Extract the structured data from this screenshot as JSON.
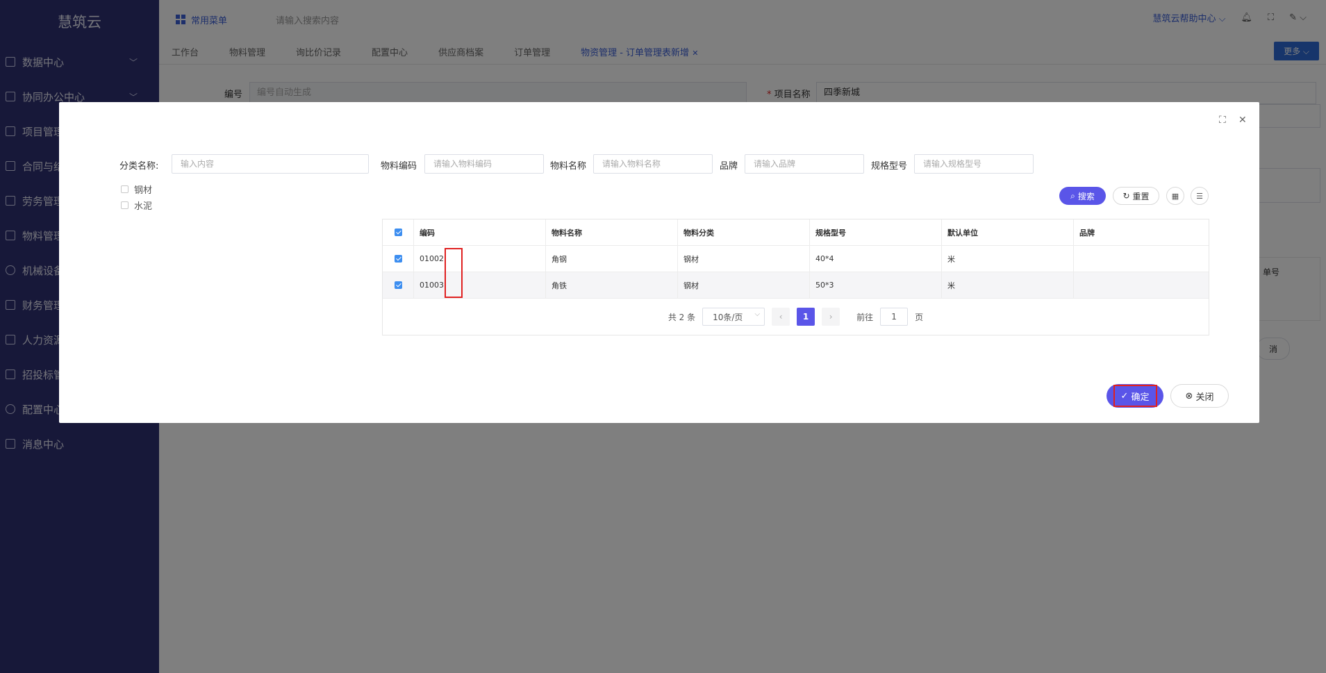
{
  "app": {
    "brand": "慧筑云"
  },
  "sidebar": {
    "items": [
      {
        "label": "数据中心",
        "icon": "grid-icon"
      },
      {
        "label": "协同办公中心",
        "icon": "send-icon"
      },
      {
        "label": "项目管理",
        "icon": "book-icon"
      },
      {
        "label": "合同与结",
        "icon": "edit-icon"
      },
      {
        "label": "劳务管理",
        "icon": "user-icon"
      },
      {
        "label": "物料管理",
        "icon": "edit-icon"
      },
      {
        "label": "机械设备",
        "icon": "gear-circle-icon"
      },
      {
        "label": "财务管理",
        "icon": "phone-icon"
      },
      {
        "label": "人力资源",
        "icon": "phone-icon"
      },
      {
        "label": "招投标管",
        "icon": "swap-icon"
      },
      {
        "label": "配置中心",
        "icon": "settings-icon"
      },
      {
        "label": "消息中心",
        "icon": "message-icon"
      }
    ]
  },
  "topbar": {
    "menu_label": "常用菜单",
    "search_placeholder": "请输入搜索内容",
    "help_label": "慧筑云帮助中心"
  },
  "tabs": [
    "工作台",
    "物料管理",
    "询比价记录",
    "配置中心",
    "供应商档案",
    "订单管理",
    "物资管理 - 订单管理表新增"
  ],
  "more_label": "更多",
  "background_form": {
    "number_label": "编号",
    "number_placeholder": "编号自动生成",
    "project_label": "项目名称",
    "project_value": "四季新城",
    "required_mark": "*",
    "hidden_col_fragment": "单号",
    "hidden_btn_fragment": "消"
  },
  "modal": {
    "category_label": "分类名称:",
    "category_placeholder": "输入内容",
    "tree": [
      "钢材",
      "水泥"
    ],
    "filters": [
      {
        "label": "物料编码",
        "placeholder": "请输入物料编码"
      },
      {
        "label": "物料名称",
        "placeholder": "请输入物料名称"
      },
      {
        "label": "品牌",
        "placeholder": "请输入品牌"
      },
      {
        "label": "规格型号",
        "placeholder": "请输入规格型号"
      }
    ],
    "search_label": "搜索",
    "reset_label": "重置",
    "table": {
      "headers": [
        "编码",
        "物料名称",
        "物料分类",
        "规格型号",
        "默认单位",
        "品牌"
      ],
      "rows": [
        {
          "code": "01002",
          "name": "角钢",
          "category": "钢材",
          "spec": "40*4",
          "unit": "米",
          "brand": ""
        },
        {
          "code": "01003",
          "name": "角铁",
          "category": "钢材",
          "spec": "50*3",
          "unit": "米",
          "brand": ""
        }
      ]
    },
    "pager": {
      "total": "共 2 条",
      "page_size": "10条/页",
      "current": "1",
      "goto_prefix": "前往",
      "goto_value": "1",
      "goto_suffix": "页"
    },
    "confirm_label": "确定",
    "close_label": "关闭"
  }
}
